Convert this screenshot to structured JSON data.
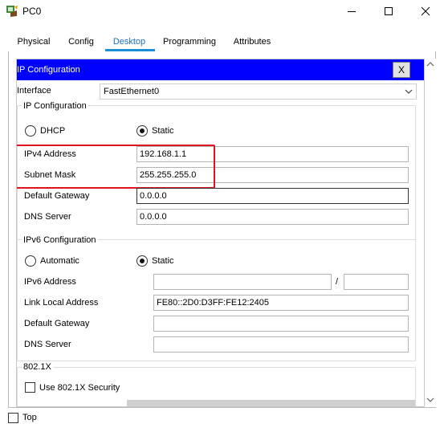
{
  "window": {
    "title": "PC0",
    "minimize_icon": "minimize-icon",
    "maximize_icon": "maximize-icon",
    "close_icon": "close-icon"
  },
  "tabs": [
    {
      "label": "Physical"
    },
    {
      "label": "Config"
    },
    {
      "label": "Desktop",
      "active": true
    },
    {
      "label": "Programming"
    },
    {
      "label": "Attributes"
    }
  ],
  "ip_config": {
    "header_title": "IP Configuration",
    "close_label": "X",
    "interface_label": "Interface",
    "interface_value": "FastEthernet0",
    "ipv4": {
      "group_title": "IP Configuration",
      "dhcp_label": "DHCP",
      "static_label": "Static",
      "mode": "Static",
      "ipv4_label": "IPv4 Address",
      "ipv4_value": "192.168.1.1",
      "subnet_label": "Subnet Mask",
      "subnet_value": "255.255.255.0",
      "gateway_label": "Default Gateway",
      "gateway_value": "0.0.0.0",
      "dns_label": "DNS Server",
      "dns_value": "0.0.0.0"
    },
    "ipv6": {
      "group_title": "IPv6 Configuration",
      "auto_label": "Automatic",
      "static_label": "Static",
      "mode": "Static",
      "address_label": "IPv6 Address",
      "address_value": "",
      "prefix_sep": "/",
      "prefix_value": "",
      "link_local_label": "Link Local Address",
      "link_local_value": "FE80::2D0:D3FF:FE12:2405",
      "gateway_label": "Default Gateway",
      "gateway_value": "",
      "dns_label": "DNS Server",
      "dns_value": ""
    },
    "dot1x": {
      "group_title": "802.1X",
      "use_label": "Use 802.1X Security",
      "checked": false
    }
  },
  "bottom": {
    "top_label": "Top",
    "top_checked": false
  },
  "colors": {
    "header_blue": "#0000ff",
    "highlight_red": "#e0141e",
    "active_tab": "#1a8fd6"
  }
}
